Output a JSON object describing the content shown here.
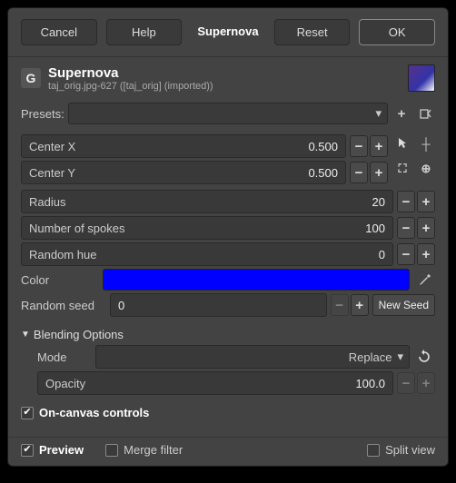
{
  "buttons": {
    "cancel": "Cancel",
    "help": "Help",
    "title": "Supernova",
    "reset": "Reset",
    "ok": "OK"
  },
  "header": {
    "title": "Supernova",
    "subtitle": "taj_orig.jpg-627 ([taj_orig] (imported))"
  },
  "presets": {
    "label": "Presets:"
  },
  "fields": {
    "centerX": {
      "label": "Center X",
      "value": "0.500"
    },
    "centerY": {
      "label": "Center Y",
      "value": "0.500"
    },
    "radius": {
      "label": "Radius",
      "value": "20"
    },
    "spokes": {
      "label": "Number of spokes",
      "value": "100"
    },
    "randomHue": {
      "label": "Random hue",
      "value": "0"
    },
    "color": {
      "label": "Color",
      "value": "#0000ff"
    },
    "randomSeed": {
      "label": "Random seed",
      "value": "0",
      "newSeed": "New Seed"
    }
  },
  "blending": {
    "title": "Blending Options",
    "modeLabel": "Mode",
    "modeValue": "Replace",
    "opacityLabel": "Opacity",
    "opacityValue": "100.0"
  },
  "checks": {
    "onCanvas": "On-canvas controls",
    "preview": "Preview",
    "merge": "Merge filter",
    "split": "Split view"
  }
}
